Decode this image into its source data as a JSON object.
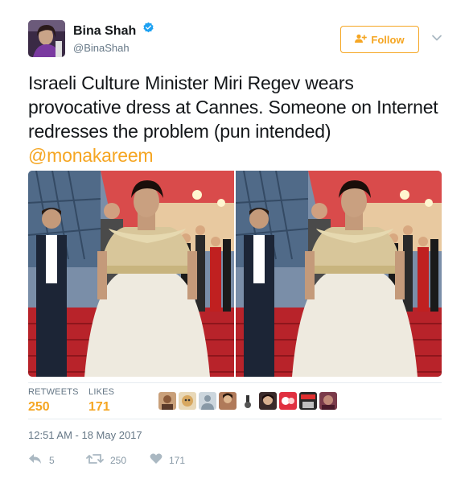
{
  "user": {
    "name": "Bina Shah",
    "handle": "@BinaShah",
    "avatar_icon": "profile-photo",
    "verified_icon": "verified-badge-icon"
  },
  "follow": {
    "label": "Follow",
    "icon": "add-user-icon"
  },
  "tweet": {
    "text": "Israeli Culture Minister Miri Regev wears provocative dress at Cannes. Someone on Internet redresses the problem (pun intended) ",
    "mention": "@monakareem"
  },
  "media": [
    {
      "description_icon": "photo-original"
    },
    {
      "description_icon": "photo-edited"
    }
  ],
  "stats": {
    "retweets_label": "RETWEETS",
    "retweets_value": "250",
    "likes_label": "LIKES",
    "likes_value": "171",
    "liker_avatars": 9
  },
  "timestamp": "12:51 AM - 18 May 2017",
  "actions": {
    "reply_count": "5",
    "retweet_count": "250",
    "like_count": "171"
  },
  "colors": {
    "accent": "#f5a623",
    "verified": "#1da1f2",
    "muted": "#657786",
    "divider": "#e6ecf0"
  }
}
